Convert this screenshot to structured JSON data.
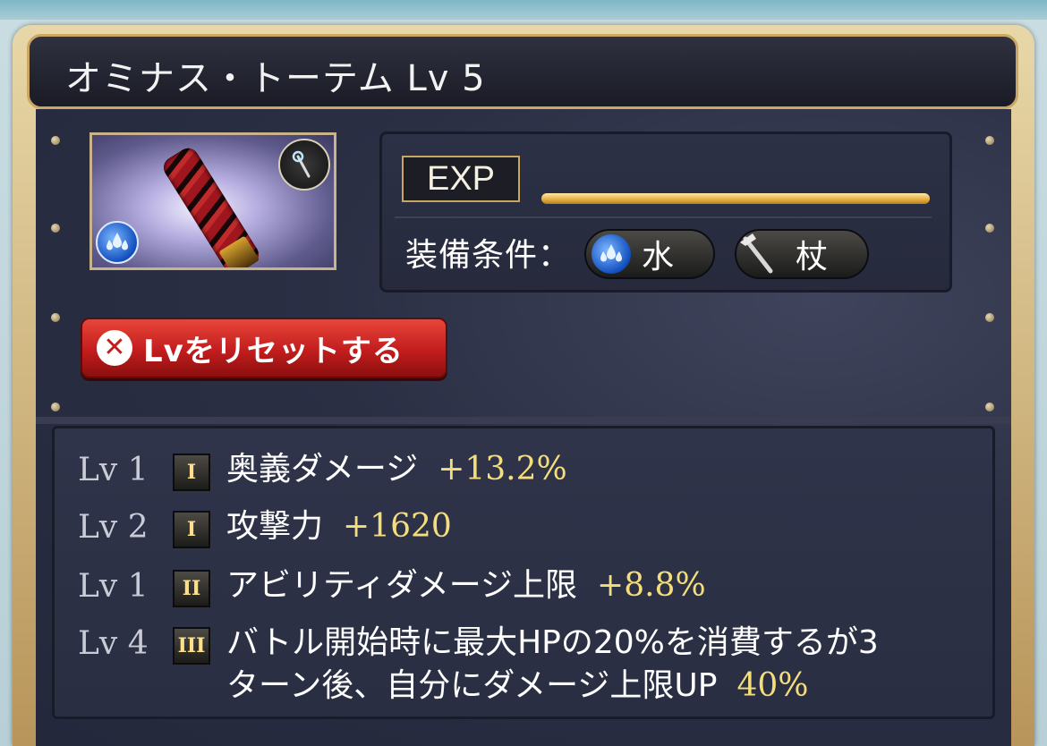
{
  "title": "オミナス・トーテム Lv 5",
  "exp": {
    "label": "EXP",
    "progress_fraction": 1.0
  },
  "requirements": {
    "label": "装備条件：",
    "element": {
      "label": "水",
      "icon": "water-element-icon"
    },
    "weapon": {
      "label": "杖",
      "icon": "staff-icon"
    }
  },
  "reset_button": {
    "label": "Lvをリセットする",
    "icon": "close-circle-icon"
  },
  "skills": [
    {
      "level": "Lv 1",
      "rank": "I",
      "name": "奥義ダメージ",
      "value": "+13.2%"
    },
    {
      "level": "Lv 2",
      "rank": "I",
      "name": "攻撃力",
      "value": "+1620"
    },
    {
      "level": "Lv 1",
      "rank": "II",
      "name": "アビリティダメージ上限",
      "value": "+8.8%"
    },
    {
      "level": "Lv 4",
      "rank": "III",
      "name": "バトル開始時に最大HPの20%を消費するが3",
      "name_line2": "ターン後、自分にダメージ上限UP",
      "value": "40%"
    }
  ],
  "colors": {
    "accent_gold": "#e3ae3f",
    "value_yellow": "#f4de7c",
    "reset_red": "#c21d1d"
  }
}
